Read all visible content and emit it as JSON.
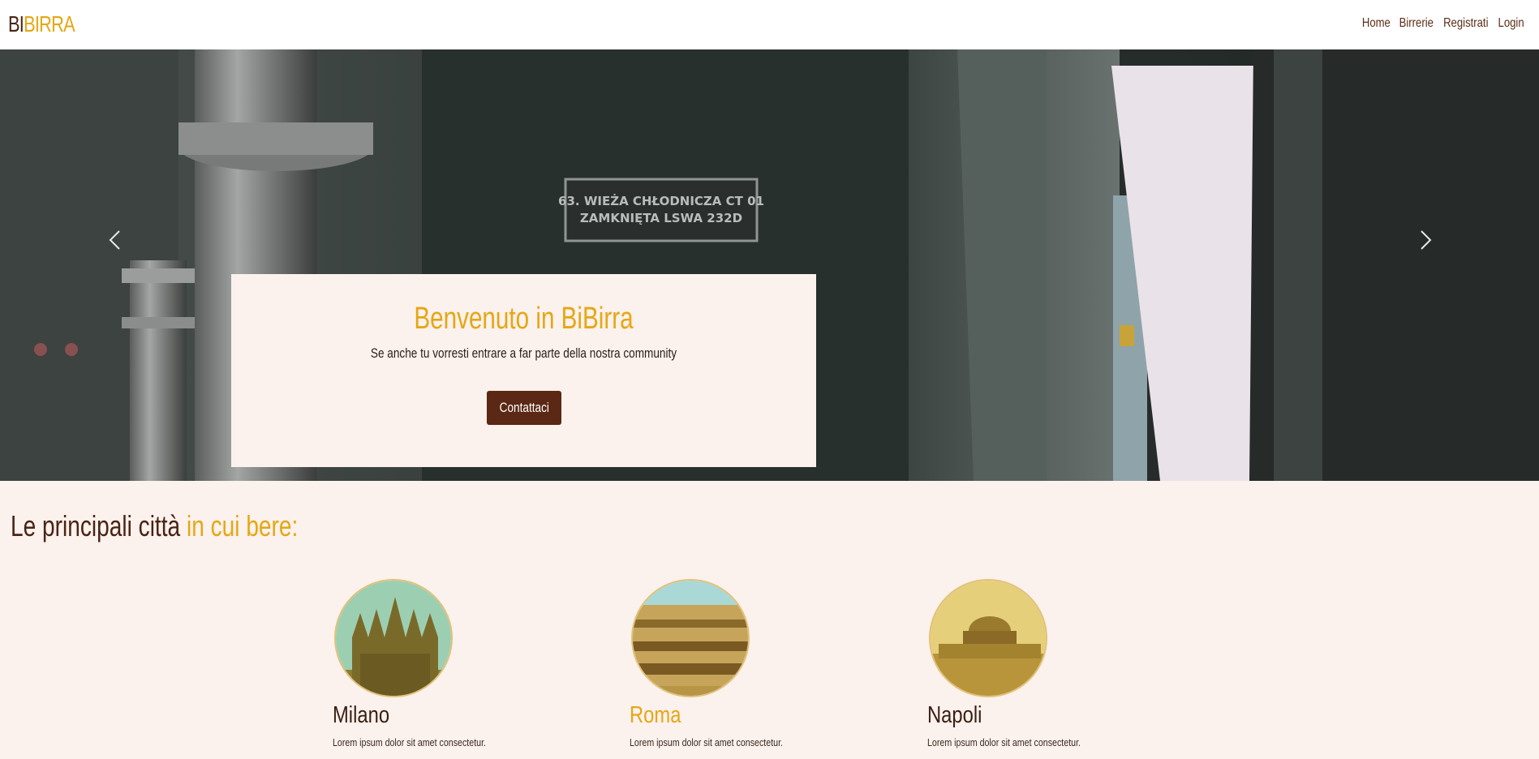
{
  "brand": {
    "part1": "BI",
    "part2": "BIRRA"
  },
  "nav": {
    "links": [
      "Home",
      "Birrerie",
      "Registrati",
      "Login"
    ]
  },
  "hero": {
    "sign_line1": "63. WIEŻA CHŁODNICZA CT 01",
    "sign_line2": "ZAMKNIĘTA LSWA 232D",
    "title": "Benvenuto in BiBirra",
    "subtitle": "Se anche tu vorresti entrare a far parte della nostra community",
    "cta_label": "Contattaci"
  },
  "cities_section": {
    "title_main": "Le principali città",
    "title_highlight": "in cui bere:",
    "cities": [
      {
        "name": "Milano",
        "desc": "Lorem ipsum dolor sit amet consectetur."
      },
      {
        "name": "Roma",
        "desc": "Lorem ipsum dolor sit amet consectetur."
      },
      {
        "name": "Napoli",
        "desc": "Lorem ipsum dolor sit amet consectetur."
      }
    ]
  },
  "colors": {
    "accent": "#e5a713",
    "brown": "#5a2814",
    "bg": "#fbf1ed"
  }
}
